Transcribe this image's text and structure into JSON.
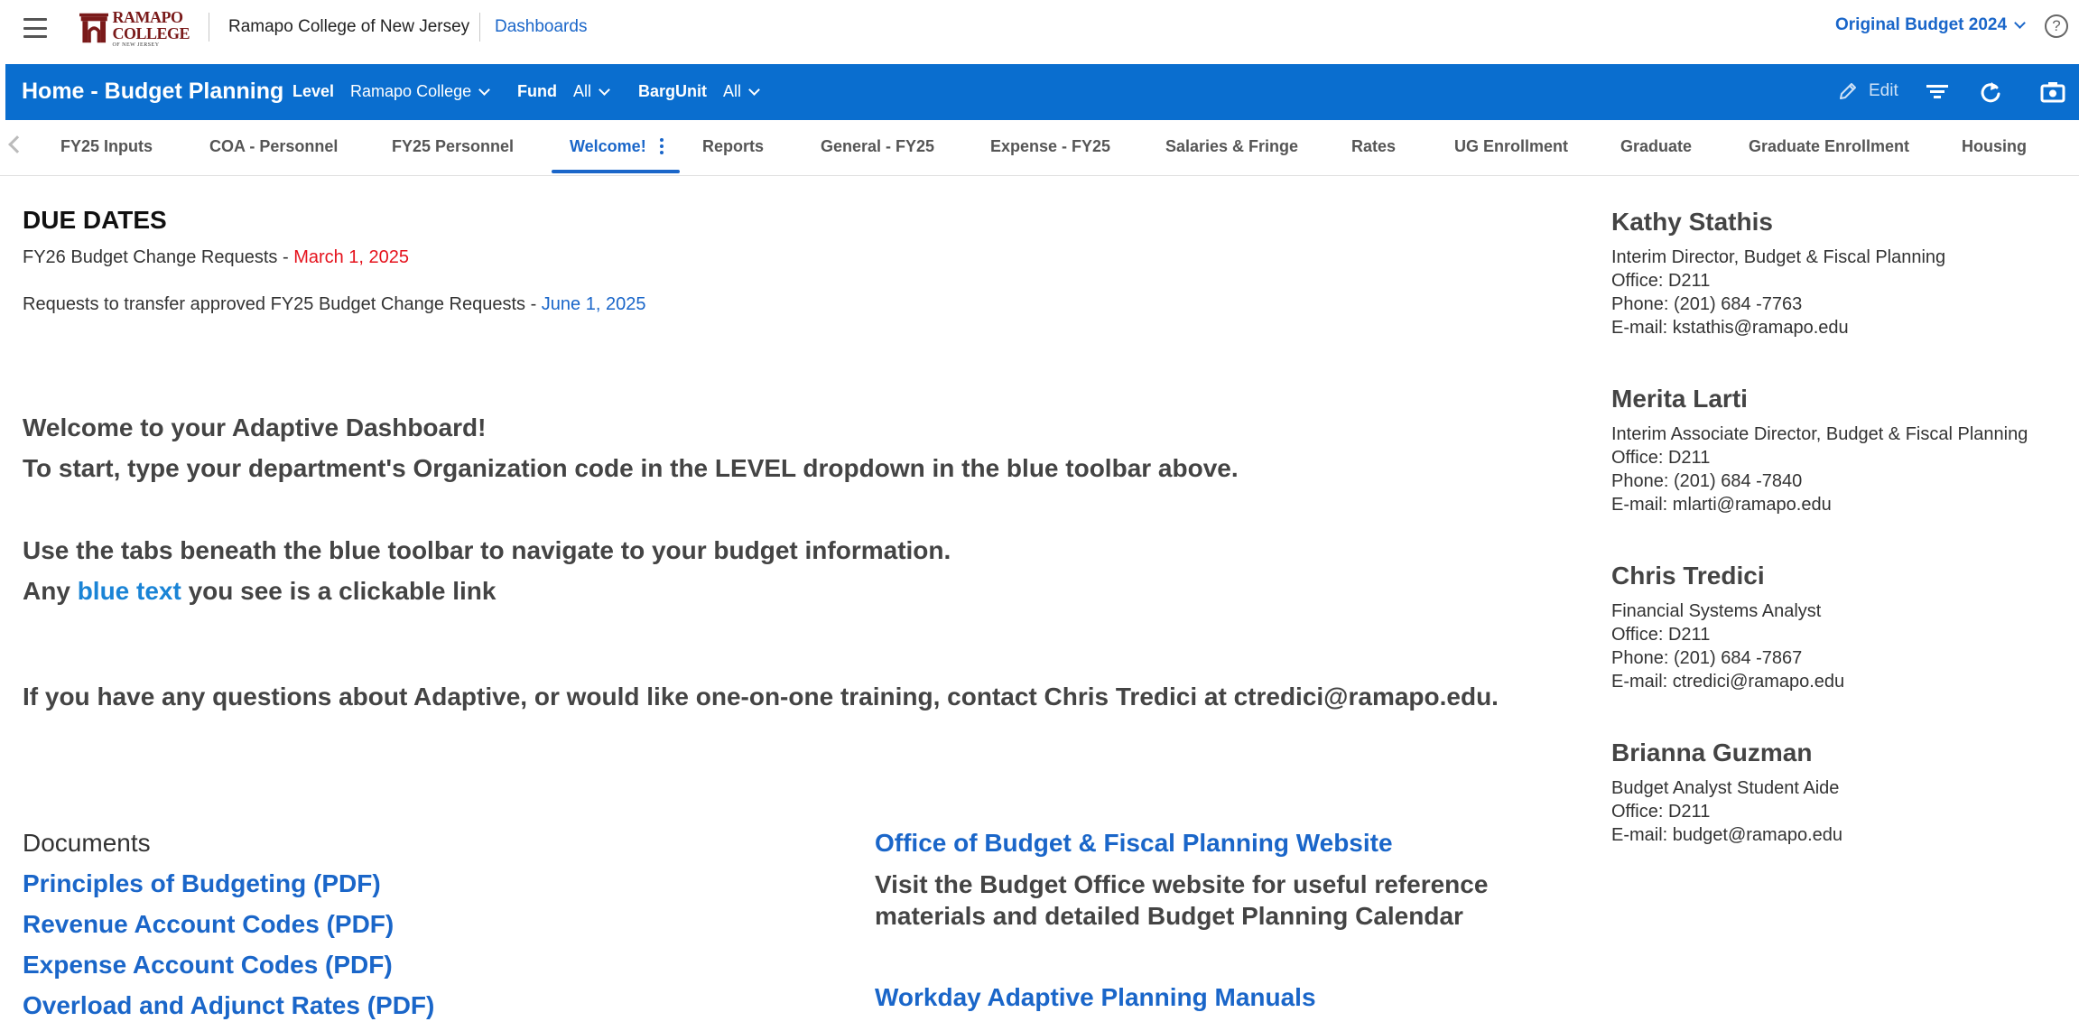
{
  "header": {
    "logo_line1": "RAMAPO",
    "logo_line2": "COLLEGE",
    "logo_line3": "OF NEW JERSEY",
    "org_name": "Ramapo College of New Jersey",
    "dashboards_link": "Dashboards",
    "version": "Original Budget 2024",
    "help": "?"
  },
  "toolbar": {
    "title": "Home - Budget Planning",
    "level_label": "Level",
    "level_value": "Ramapo College",
    "fund_label": "Fund",
    "fund_value": "All",
    "barg_label": "BargUnit",
    "barg_value": "All",
    "edit_label": "Edit"
  },
  "tabs": [
    "FY25 Inputs",
    "COA - Personnel",
    "FY25 Personnel",
    "Welcome!",
    "Reports",
    "General - FY25",
    "Expense - FY25",
    "Salaries & Fringe",
    "Rates",
    "UG Enrollment",
    "Graduate",
    "Graduate Enrollment",
    "Housing"
  ],
  "due_dates": {
    "title": "DUE DATES",
    "line1_text": "FY26 Budget Change Requests - ",
    "line1_date": "March 1, 2025",
    "line2_text": "Requests to transfer approved FY25 Budget Change Requests - ",
    "line2_date": "June 1, 2025"
  },
  "welcome": {
    "line1": "Welcome to your Adaptive Dashboard!",
    "line2": "To start, type your department's Organization code in the LEVEL dropdown in the blue toolbar above.",
    "line3": "Use the tabs beneath the blue toolbar to navigate to your budget information.",
    "line4_pre": "Any ",
    "line4_link": "blue text",
    "line4_post": " you see is a clickable link",
    "line5": "If you have any questions about Adaptive, or would like one-on-one training, contact Chris Tredici at ctredici@ramapo.edu."
  },
  "documents": {
    "title": "Documents",
    "links": [
      "Principles of Budgeting (PDF)",
      "Revenue Account Codes (PDF)",
      "Expense Account Codes (PDF)",
      "Overload and Adjunct Rates (PDF)"
    ]
  },
  "office": {
    "website_link": "Office of Budget & Fiscal Planning Website",
    "desc_line1": "Visit the Budget Office website for useful reference",
    "desc_line2": "materials and detailed Budget Planning Calendar",
    "manuals_link": "Workday Adaptive Planning Manuals"
  },
  "contacts": [
    {
      "name": "Kathy Stathis",
      "title": "Interim Director, Budget & Fiscal Planning",
      "office": "Office: D211",
      "phone": "Phone: (201) 684 -7763",
      "email": "E-mail: kstathis@ramapo.edu"
    },
    {
      "name": "Merita Larti",
      "title": "Interim Associate Director, Budget & Fiscal Planning",
      "office": "Office: D211",
      "phone": "Phone: (201) 684 -7840",
      "email": "E-mail: mlarti@ramapo.edu"
    },
    {
      "name": "Chris Tredici",
      "title": "Financial Systems Analyst",
      "office": "Office: D211",
      "phone": "Phone: (201) 684 -7867",
      "email": "E-mail: ctredici@ramapo.edu"
    },
    {
      "name": "Brianna Guzman",
      "title": "Budget Analyst Student Aide",
      "office": "Office: D211",
      "email": "E-mail: budget@ramapo.edu"
    }
  ],
  "colors": {
    "toolbar_blue": "#0a6ecf",
    "link_blue": "#1a66c9",
    "due_red": "#e5131d",
    "logo_maroon": "#7a1a1a"
  },
  "icons": {
    "menu": "hamburger-menu-icon",
    "edit": "pencil-icon",
    "filter": "filter-icon",
    "refresh": "refresh-icon",
    "snapshot": "camera-icon",
    "help": "help-circle-icon"
  }
}
